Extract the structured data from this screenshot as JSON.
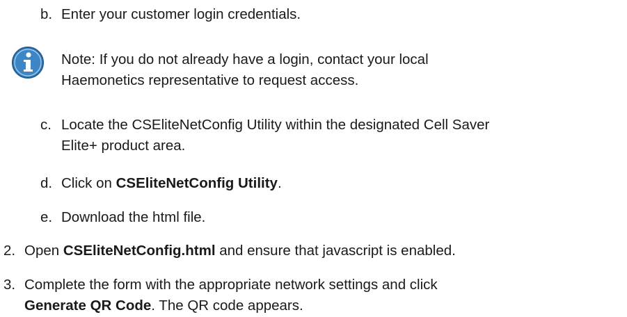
{
  "items": {
    "b": {
      "marker": "b.",
      "text": "Enter your customer login credentials."
    },
    "note": {
      "icon": "info-icon",
      "line1": "Note: If you do not already have a login, contact your local",
      "line2": "Haemonetics representative to request access."
    },
    "c": {
      "marker": "c.",
      "line1": "Locate the CSEliteNetConfig Utility within the designated Cell Saver",
      "line2": "Elite+ product area."
    },
    "d": {
      "marker": "d.",
      "pre": "Click on ",
      "bold": "CSEliteNetConfig Utility",
      "post": "."
    },
    "e": {
      "marker": "e.",
      "text": "Download the html file."
    },
    "step2": {
      "marker": "2.",
      "pre": "Open ",
      "bold": "CSEliteNetConfig.html",
      "post": " and ensure that javascript is enabled."
    },
    "step3": {
      "marker": "3.",
      "line1": "Complete the form with the appropriate network settings and click",
      "bold": "Generate QR Code",
      "post": ". The QR code appears."
    }
  },
  "colors": {
    "icon_fill": "#3d86c6",
    "icon_border": "#1f5e93",
    "text": "#1a1a1a"
  }
}
